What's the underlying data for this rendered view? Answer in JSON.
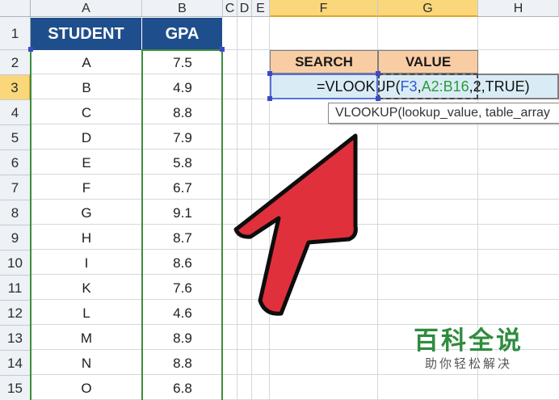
{
  "columns": [
    "A",
    "B",
    "C",
    "D",
    "E",
    "F",
    "G",
    "H"
  ],
  "rows": [
    "1",
    "2",
    "3",
    "4",
    "5",
    "6",
    "7",
    "8",
    "9",
    "10",
    "11",
    "12",
    "13",
    "14",
    "15"
  ],
  "table": {
    "headers": [
      "STUDENT",
      "GPA"
    ],
    "records": [
      {
        "student": "A",
        "gpa": "7.5"
      },
      {
        "student": "B",
        "gpa": "4.9"
      },
      {
        "student": "C",
        "gpa": "8.8"
      },
      {
        "student": "D",
        "gpa": "7.9"
      },
      {
        "student": "E",
        "gpa": "5.8"
      },
      {
        "student": "F",
        "gpa": "6.7"
      },
      {
        "student": "G",
        "gpa": "9.1"
      },
      {
        "student": "H",
        "gpa": "8.7"
      },
      {
        "student": "I",
        "gpa": "8.6"
      },
      {
        "student": "K",
        "gpa": "7.6"
      },
      {
        "student": "L",
        "gpa": "4.6"
      },
      {
        "student": "M",
        "gpa": "8.9"
      },
      {
        "student": "N",
        "gpa": "8.8"
      },
      {
        "student": "O",
        "gpa": "6.8"
      }
    ]
  },
  "lookup": {
    "search_label": "SEARCH",
    "value_label": "VALUE"
  },
  "formula": {
    "prefix": "=VLOOKUP(",
    "ref1": "F3",
    "comma1": ",",
    "ref2": "A2:B16",
    "suffix": ",2,TRUE)"
  },
  "tooltip": {
    "text": "VLOOKUP(lookup_value, table_array"
  },
  "watermark": {
    "title": "百科全说",
    "subtitle": "助你轻松解决"
  },
  "colors": {
    "header_fill": "#1f4e8c",
    "lookup_header_fill": "#f9cda4",
    "formula_cell_fill": "#d9ecf6",
    "arrow_fill": "#e0303c",
    "watermark_green": "#2f8c3e",
    "selected_header": "#f9d77a"
  },
  "icons": {
    "pointer": "big-red-arrow-icon"
  }
}
